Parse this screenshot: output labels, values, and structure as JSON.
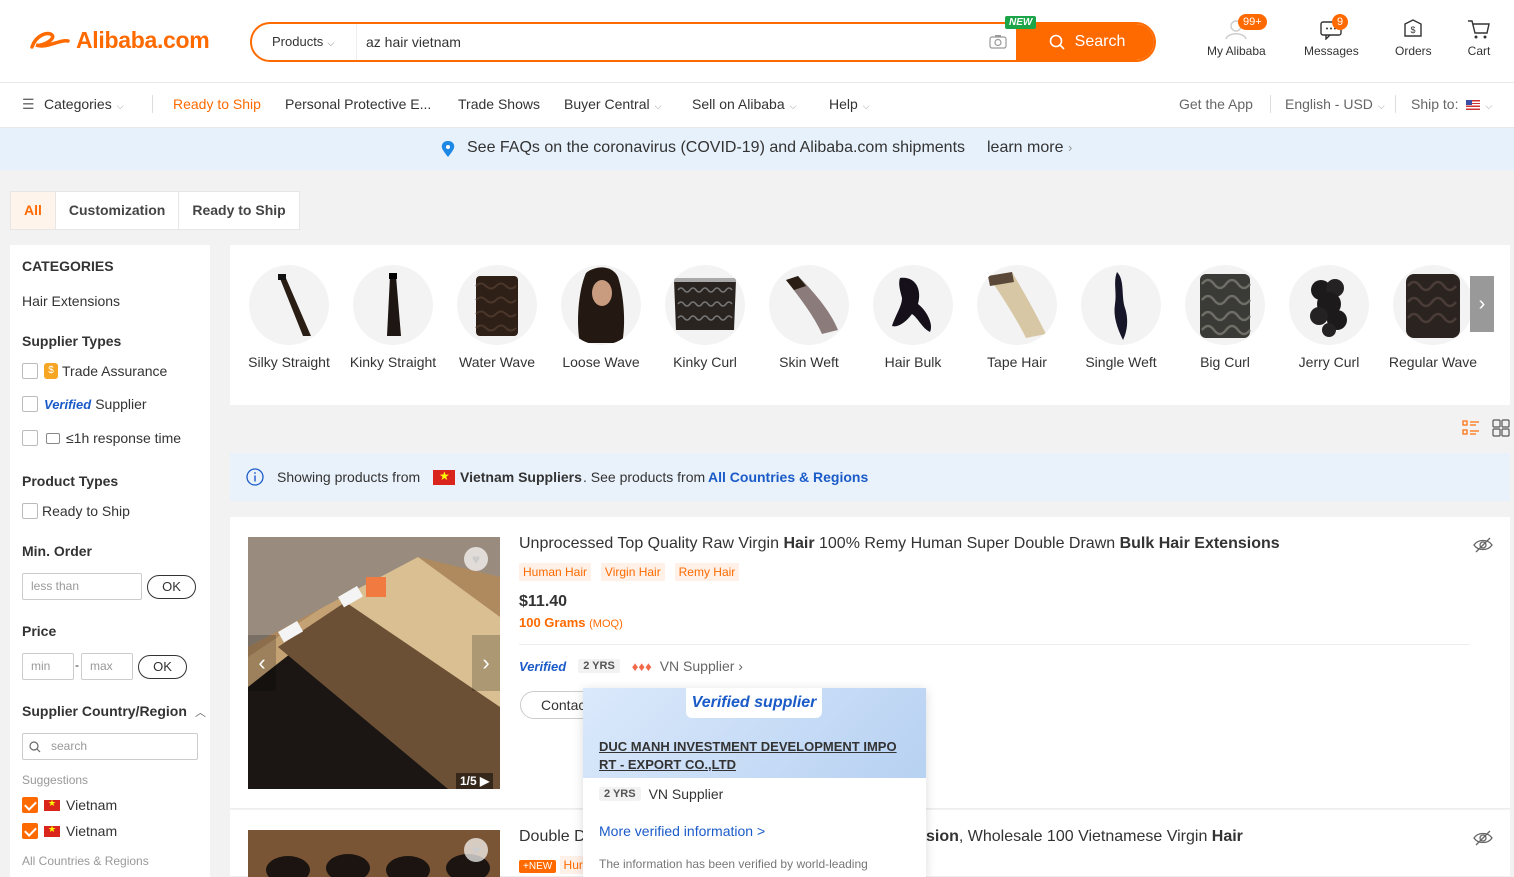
{
  "header": {
    "logo": "Alibaba.com",
    "search_scope": "Products",
    "search_value": "az hair vietnam",
    "new_badge": "NEW",
    "search_button": "Search",
    "my_alibaba": "My Alibaba",
    "my_alibaba_badge": "99+",
    "messages": "Messages",
    "messages_badge": "9",
    "orders": "Orders",
    "cart": "Cart"
  },
  "nav": {
    "categories": "Categories",
    "ready_to_ship": "Ready to Ship",
    "ppe": "Personal Protective E...",
    "trade_shows": "Trade Shows",
    "buyer_central": "Buyer Central",
    "sell": "Sell on Alibaba",
    "help": "Help",
    "get_app": "Get the App",
    "language": "English - USD",
    "ship_to": "Ship to:"
  },
  "covid": {
    "text": "See FAQs on the coronavirus (COVID-19) and Alibaba.com shipments",
    "link": "learn more"
  },
  "tabs": [
    "All",
    "Customization",
    "Ready to Ship"
  ],
  "sidebar": {
    "categories_heading": "CATEGORIES",
    "category": "Hair Extensions",
    "supplier_types_heading": "Supplier Types",
    "trade_assurance": "Trade Assurance",
    "verified_logo": "Verified",
    "verified_supplier": "Supplier",
    "response_time": "≤1h response time",
    "product_types_heading": "Product Types",
    "ready_to_ship": "Ready to Ship",
    "min_order_heading": "Min. Order",
    "min_order_placeholder": "less than",
    "ok": "OK",
    "price_heading": "Price",
    "price_min": "min",
    "price_max": "max",
    "price_dash": "-",
    "country_heading": "Supplier Country/Region",
    "country_search": "search",
    "suggestions": "Suggestions",
    "countries": [
      "Vietnam",
      "Vietnam"
    ],
    "all_countries": "All Countries & Regions"
  },
  "category_strip": [
    {
      "label": "Silky Straight",
      "icon": "straight-hair-bundle"
    },
    {
      "label": "Kinky Straight",
      "icon": "straight-hair-bundle"
    },
    {
      "label": "Water Wave",
      "icon": "curly-hair-bundle"
    },
    {
      "label": "Loose Wave",
      "icon": "wig-head"
    },
    {
      "label": "Kinky Curl",
      "icon": "lace-frontal"
    },
    {
      "label": "Skin Weft",
      "icon": "skin-weft"
    },
    {
      "label": "Hair Bulk",
      "icon": "bulk-hair"
    },
    {
      "label": "Tape Hair",
      "icon": "tape-hair"
    },
    {
      "label": "Single Weft",
      "icon": "weft-hair"
    },
    {
      "label": "Big Curl",
      "icon": "curly-hair-bundle"
    },
    {
      "label": "Jerry Curl",
      "icon": "curly-hair-bundle"
    },
    {
      "label": "Regular Wave",
      "icon": "curly-hair-bundle"
    }
  ],
  "notice": {
    "prefix": "Showing products from",
    "country": "Vietnam Suppliers",
    "middle": ". See products from",
    "link": "All Countries & Regions"
  },
  "products": [
    {
      "title_parts": [
        "Unprocessed Top Quality Raw Virgin ",
        "Hair",
        " 100% Remy Human Super Double Drawn ",
        "Bulk Hair Extensions"
      ],
      "tags": [
        "Human Hair",
        "Virgin Hair",
        "Remy Hair"
      ],
      "price": "$11.40",
      "moq": "100 Grams",
      "moq_label": "(MOQ)",
      "verified": "Verified",
      "years": "2 YRS",
      "supplier_country": "VN Supplier",
      "contact": "Contac",
      "pager": "1/5"
    },
    {
      "title_left": "Double D",
      "title_right_bold": "sion",
      "title_right_mid": ", Wholesale 100 Vietnamese Virgin ",
      "title_right_bold2": "Hair",
      "tag_new": "NEW",
      "tag_text": "Hur"
    }
  ],
  "popup": {
    "badge": "Verified supplier",
    "company": "DUC MANH INVESTMENT DEVELOPMENT IMPO RT - EXPORT CO.,LTD",
    "years": "2 YRS",
    "country": "VN Supplier",
    "more": "More verified information >",
    "note": "The information has been verified by world-leading"
  },
  "colors": {
    "accent": "#ff6a00",
    "link": "#1a5bc8",
    "banner": "#e7f1fb"
  }
}
